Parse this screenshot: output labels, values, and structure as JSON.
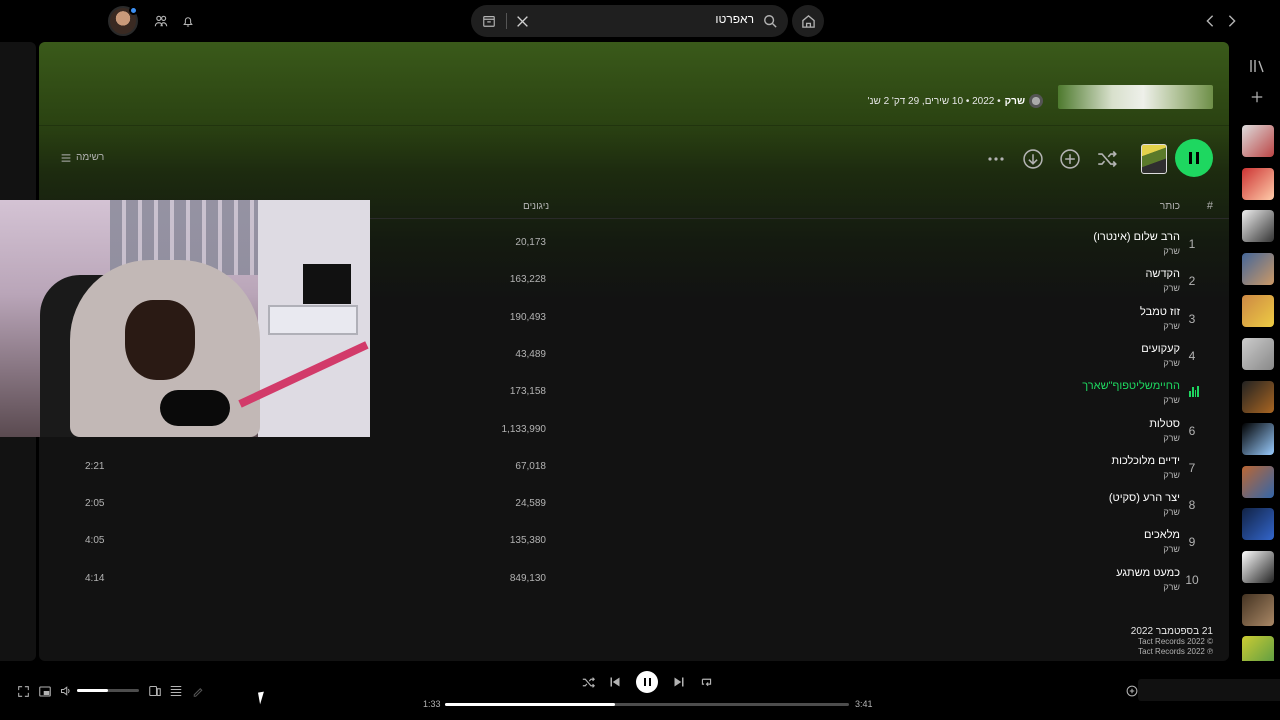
{
  "search": {
    "query": "ראפרטו"
  },
  "album": {
    "artist": "שרק",
    "meta": "• 2022 • 10 שירים, 29 דק' 2 שנ'"
  },
  "controls": {
    "list_view_label": "רשימה"
  },
  "columns": {
    "hash": "#",
    "title": "כותר",
    "plays": "ניגונים"
  },
  "tracks": [
    {
      "num": "1",
      "title": "הרב שלום (אינטרו)",
      "artist": "שרק",
      "plays": "20,173",
      "duration": ""
    },
    {
      "num": "2",
      "title": "הקדשה",
      "artist": "שרק",
      "plays": "163,228",
      "duration": ""
    },
    {
      "num": "3",
      "title": "זוז טמבל",
      "artist": "שרק",
      "plays": "190,493",
      "duration": ""
    },
    {
      "num": "4",
      "title": "קעקועים",
      "artist": "שרק",
      "plays": "43,489",
      "duration": ""
    },
    {
      "num": "5",
      "title": "החיימשליטפוף\"שארך",
      "artist": "שרק",
      "plays": "173,158",
      "duration": "",
      "playing": true
    },
    {
      "num": "6",
      "title": "סטלות",
      "artist": "שרק",
      "plays": "1,133,990",
      "duration": ""
    },
    {
      "num": "7",
      "title": "ידיים מלוכלכות",
      "artist": "שרק",
      "plays": "67,018",
      "duration": "2:21"
    },
    {
      "num": "8",
      "title": "יצר הרע (סקיט)",
      "artist": "שרק",
      "plays": "24,589",
      "duration": "2:05"
    },
    {
      "num": "9",
      "title": "מלאכים",
      "artist": "שרק",
      "plays": "135,380",
      "duration": "4:05"
    },
    {
      "num": "10",
      "title": "כמעט משתגע",
      "artist": "שרק",
      "plays": "849,130",
      "duration": "4:14"
    }
  ],
  "footer": {
    "release_date": "21 בספטמבר 2022",
    "copyright": "© 2022 Tact Records",
    "phonogram": "℗ 2022 Tact Records"
  },
  "player": {
    "elapsed": "1:33",
    "total": "3:41",
    "progress": 0.42,
    "volume": 0.5
  },
  "colors": {
    "accent": "#1ed760",
    "header_green": "#3a5a1a"
  }
}
